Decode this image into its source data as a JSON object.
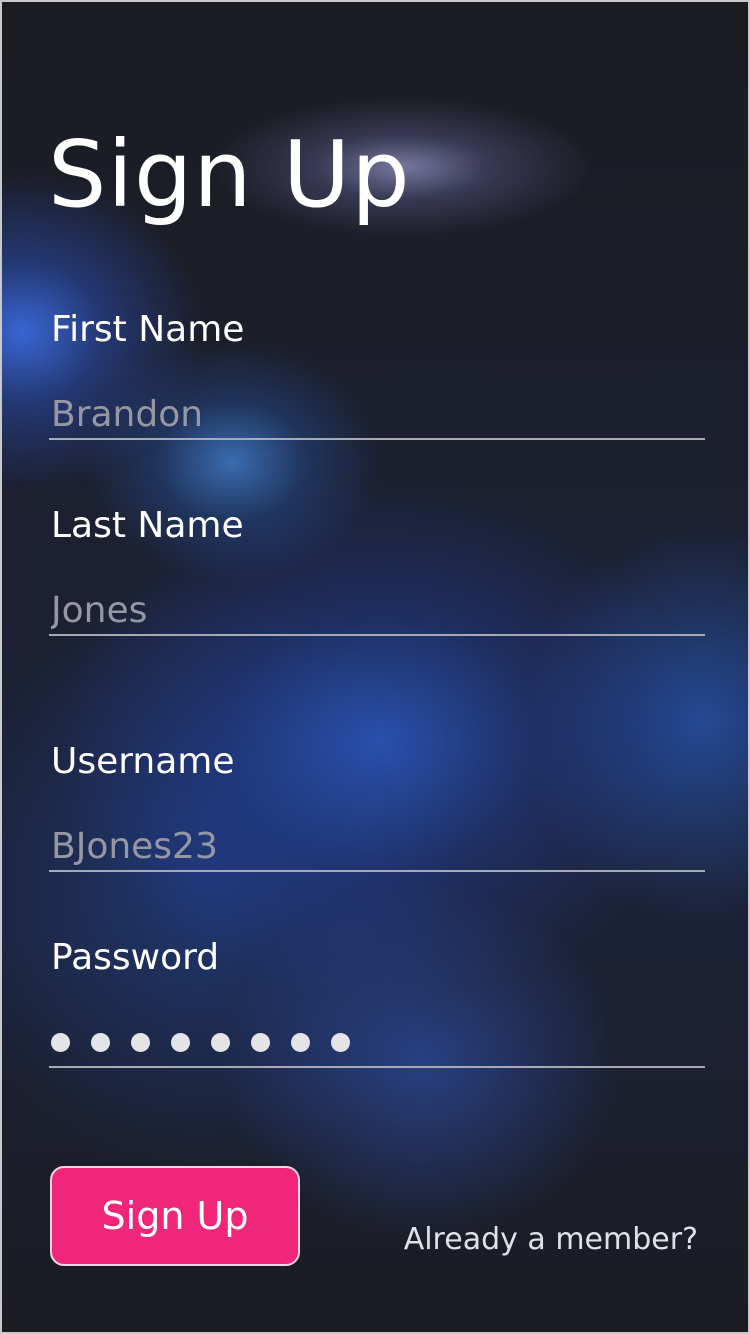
{
  "header": {
    "title": "Sign Up"
  },
  "form": {
    "first_name": {
      "label": "First Name",
      "value": "Brandon"
    },
    "last_name": {
      "label": "Last Name",
      "value": "Jones"
    },
    "username": {
      "label": "Username",
      "value": "BJones23"
    },
    "password": {
      "label": "Password",
      "masked_length": 8
    }
  },
  "actions": {
    "signup_label": "Sign Up",
    "member_link": "Already a member?"
  },
  "colors": {
    "accent": "#f0267a",
    "background": "#1c1d22",
    "input_text": "#9598a3",
    "underline": "#a8aab2"
  }
}
